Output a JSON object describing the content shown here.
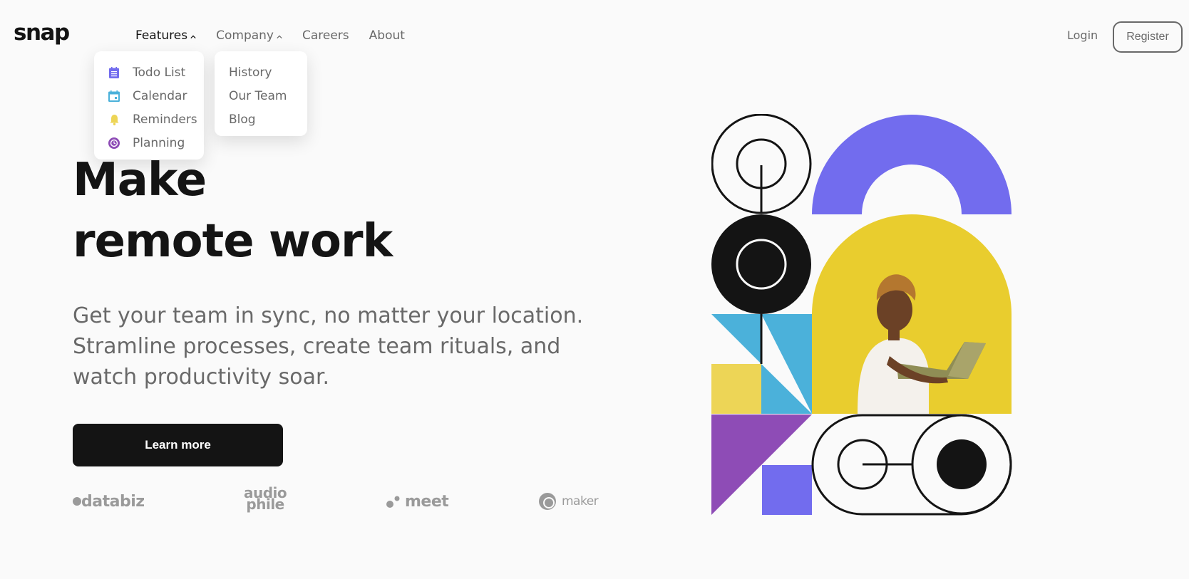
{
  "header": {
    "logo": "snap",
    "nav": [
      {
        "label": "Features",
        "has_dropdown": true
      },
      {
        "label": "Company",
        "has_dropdown": true
      },
      {
        "label": "Careers"
      },
      {
        "label": "About"
      }
    ],
    "login_label": "Login",
    "register_label": "Register"
  },
  "features_menu": [
    {
      "label": "Todo List",
      "icon": "todo-list-icon",
      "color": "#726CEE"
    },
    {
      "label": "Calendar",
      "icon": "calendar-icon",
      "color": "#4BB1DA"
    },
    {
      "label": "Reminders",
      "icon": "bell-icon",
      "color": "#EDD556"
    },
    {
      "label": "Planning",
      "icon": "planning-icon",
      "color": "#8E4CB6"
    }
  ],
  "company_menu": [
    {
      "label": "History"
    },
    {
      "label": "Our Team"
    },
    {
      "label": "Blog"
    }
  ],
  "hero": {
    "title_line1": "Make",
    "title_line2": "remote work",
    "description": "Get your team in sync, no matter your location. Stramline processes, create team rituals, and watch productivity soar.",
    "cta_label": "Learn more"
  },
  "clients": [
    {
      "name": "databiz"
    },
    {
      "name": "audio",
      "name_line2": "phile"
    },
    {
      "name": "meet"
    },
    {
      "name": "maker"
    }
  ],
  "colors": {
    "dark": "#141414",
    "gray": "#696969",
    "purple": "#726CEE",
    "blue": "#4BB1DA",
    "yellow": "#EDD556",
    "violet": "#8E4CB6"
  }
}
